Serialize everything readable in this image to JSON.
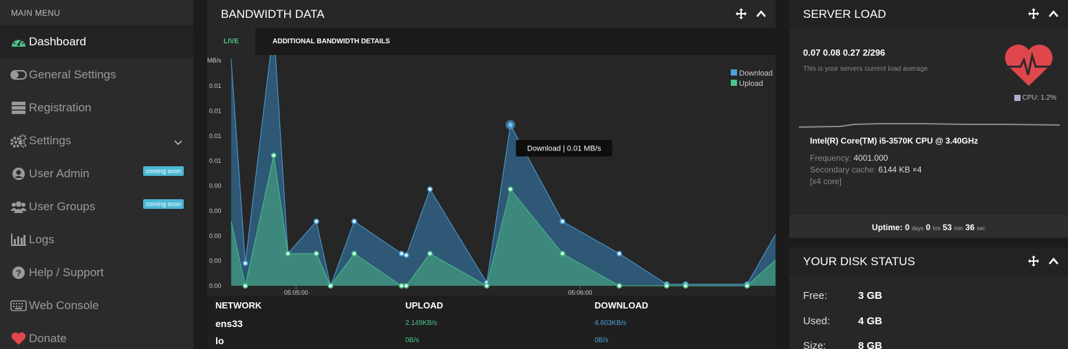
{
  "sidebar": {
    "title": "MAIN MENU",
    "items": [
      {
        "label": "Dashboard",
        "icon": "dashboard-icon"
      },
      {
        "label": "General Settings",
        "icon": "toggle-icon"
      },
      {
        "label": "Registration",
        "icon": "server-icon"
      },
      {
        "label": "Settings",
        "icon": "gears-icon"
      },
      {
        "label": "User Admin",
        "icon": "user-icon",
        "badge": "coming soon"
      },
      {
        "label": "User Groups",
        "icon": "users-icon",
        "badge": "coming soon"
      },
      {
        "label": "Logs",
        "icon": "bar-chart-icon"
      },
      {
        "label": "Help / Support",
        "icon": "question-icon"
      },
      {
        "label": "Web Console",
        "icon": "keyboard-icon"
      },
      {
        "label": "Donate",
        "icon": "heart-icon"
      }
    ]
  },
  "bandwidth": {
    "title": "BANDWIDTH DATA",
    "tabs": [
      "LIVE",
      "ADDITIONAL BANDWIDTH DETAILS"
    ],
    "tooltip": "Download | 0.01 MB/s",
    "table": {
      "headers": [
        "NETWORK",
        "UPLOAD",
        "DOWNLOAD"
      ],
      "rows": [
        {
          "network": "ens33",
          "upload": "2.149KB/s",
          "download": "4.603KB/s"
        },
        {
          "network": "lo",
          "upload": "0B/s",
          "download": "0B/s"
        }
      ]
    }
  },
  "chart_data": {
    "type": "area",
    "ylabel": "MB/s",
    "y_ticks": [
      "0.01",
      "0.01",
      "0.01",
      "0.01",
      "0.00",
      "0.00",
      "0.00",
      "0.00",
      "0.00"
    ],
    "x_ticks": [
      {
        "t": 5.36,
        "label": "05:05:00"
      },
      {
        "t": 35.36,
        "label": "05:06:00"
      }
    ],
    "ylim": [
      0,
      0.014
    ],
    "xlim": [
      -2,
      56
    ],
    "legend": "top-right",
    "series": [
      {
        "name": "Download",
        "color": "#4ca3d9",
        "x": [
          -1.5,
          0,
          3,
          4.5,
          7.5,
          9,
          11.5,
          16.5,
          17,
          19.5,
          25.5,
          28,
          33.5,
          39.5,
          44.5,
          46.5,
          53,
          56
        ],
        "y": [
          0.0141,
          0.0014,
          0.0161,
          0.002,
          0.004,
          0,
          0.004,
          0.002,
          0.0019,
          0.006,
          0.0002,
          0.01,
          0.004,
          0.002,
          0.0001,
          0.0001,
          0.0001,
          0.0032
        ]
      },
      {
        "name": "Upload",
        "color": "#48c48a",
        "x": [
          -1.5,
          0,
          3,
          4.5,
          7.5,
          9,
          11.5,
          16.5,
          17,
          19.5,
          25.5,
          28,
          33.5,
          39.5,
          44.5,
          46.5,
          53,
          56
        ],
        "y": [
          0.004,
          0,
          0.0081,
          0.002,
          0.002,
          0,
          0.002,
          0,
          0,
          0.002,
          0,
          0.006,
          0.002,
          0,
          0,
          0,
          0,
          0.0016
        ]
      }
    ]
  },
  "server_load": {
    "title": "SERVER LOAD",
    "load": "0.07 0.08 0.27 2/296",
    "subtitle": "This is your servers current load average",
    "cpu_legend": "CPU: 1.2%",
    "cpu_name": "Intel(R) Core(TM) i5-3570K CPU @ 3.40GHz",
    "frequency_label": "Frequency:",
    "frequency": "4001.000",
    "cache_label": "Secondary cache:",
    "cache": "6144 KB ×4",
    "cores": "[x4 core]",
    "uptime": {
      "label": "Uptime:",
      "days": "0",
      "days_unit": "days",
      "hrs": "0",
      "hrs_unit": "hrs",
      "min": "53",
      "min_unit": "min",
      "sec": "36",
      "sec_unit": "sec"
    }
  },
  "disk": {
    "title": "YOUR DISK STATUS",
    "rows": [
      {
        "label": "Free:",
        "value": "3 GB"
      },
      {
        "label": "Used:",
        "value": "4 GB"
      },
      {
        "label": "Size:",
        "value": "8 GB"
      }
    ]
  },
  "colors": {
    "download": "#4ca3d9",
    "upload": "#48c48a",
    "accent": "#48c48a",
    "badge": "#4cb8d6",
    "heart": "#e0474c"
  }
}
